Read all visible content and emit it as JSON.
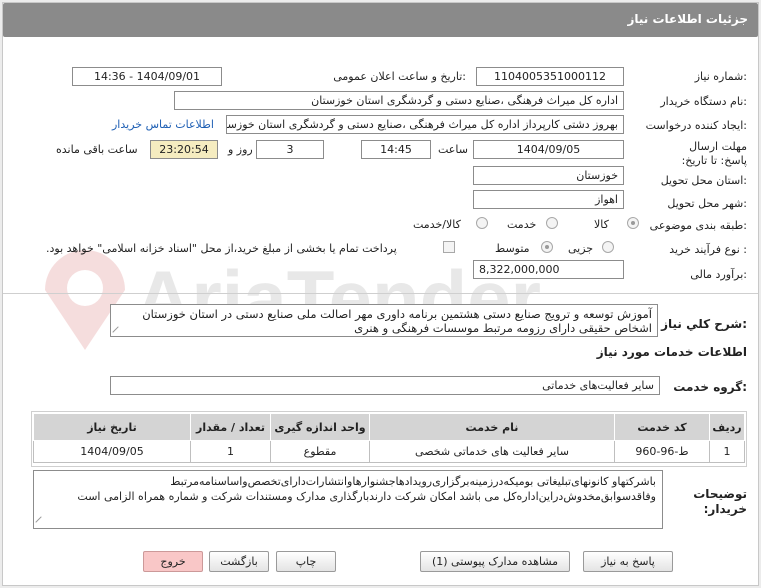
{
  "header": {
    "title": "جزئیات اطلاعات نیاز"
  },
  "form": {
    "need_number_label": "شماره نیاز:",
    "need_number": "1104005351000112",
    "announce_label": "تاریخ و ساعت اعلان عمومی:",
    "announce_value": "1404/09/01 - 14:36",
    "buyer_org_label": "نام دستگاه خریدار:",
    "buyer_org": "اداره کل میراث فرهنگی ،صنایع دستی و گردشگری استان خوزستان",
    "creator_label": "ایجاد کننده درخواست:",
    "creator": "بهروز دشتی کارپرداز اداره کل میراث فرهنگی ،صنایع دستی و گردشگری استان خوزستان",
    "contact_link": "اطلاعات تماس خریدار",
    "deadline_label": "مهلت ارسال پاسخ: تا تاریخ:",
    "deadline_date": "1404/09/05",
    "time_label": "ساعت",
    "deadline_time": "14:45",
    "days_value": "3",
    "days_label": "روز و",
    "remaining_time": "23:20:54",
    "remaining_label": "ساعت باقی مانده",
    "province_label": "استان محل تحویل:",
    "province": "خوزستان",
    "city_label": "شهر محل تحویل:",
    "city": "اهواز",
    "category_label": "طبقه بندی موضوعی:",
    "category_options": [
      "کالا",
      "خدمت",
      "کالا/خدمت"
    ],
    "process_label": "نوع فرآیند خرید :",
    "process_options": [
      "جزیی",
      "متوسط"
    ],
    "payment_note": "پرداخت تمام یا بخشی از مبلغ خرید،از محل \"اسناد خزانه اسلامی\" خواهد بود.",
    "estimate_label": "برآورد مالی:",
    "estimate": "8,322,000,000"
  },
  "description": {
    "label": "شرح کلي نياز:",
    "text": "آموزش توسعه و ترویج صنایع دستی هشتمین برنامه داوری مهر اصالت ملی صنایع دستی در استان خوزستان اشخاص حقیقی دارای رزومه مرتبط موسسات فرهنگی و هنری"
  },
  "services": {
    "section_title": "اطلاعات خدمات مورد نياز",
    "group_label": "گروه خدمت:",
    "group_value": "سایر فعالیت‌های خدماتی",
    "columns": [
      "رديف",
      "کد خدمت",
      "نام خدمت",
      "واحد اندازه گیری",
      "تعداد / مقدار",
      "تاریخ نیاز"
    ],
    "rows": [
      [
        "1",
        "ط-96-960",
        "سایر فعالیت های خدماتی شخصی",
        "مقطوع",
        "1",
        "1404/09/05"
      ]
    ]
  },
  "notes": {
    "label": "توضیحات خریدار:",
    "text": "باشرکتهاو کانونهای‌تبلیغاتی بومیکه‌درزمینه‌برگزاری‌رویدادهاجشنوارهاوانتشارات‌دارای‌تخصص‌واساسنامه‌مرتبط وفاقدسوابق‌مخدوش‌دراین‌اداره‌کل می باشد امکان شرکت دارندبارگذاری مدارک ومستندات شرکت و شماره همراه الزامی است"
  },
  "buttons": {
    "respond": "پاسخ به نیاز",
    "attachments": "مشاهده مدارک پیوستی (1)",
    "print": "چاپ",
    "back": "بازگشت",
    "exit": "خروج"
  },
  "watermark": {
    "brand": "AriaTender.net"
  }
}
